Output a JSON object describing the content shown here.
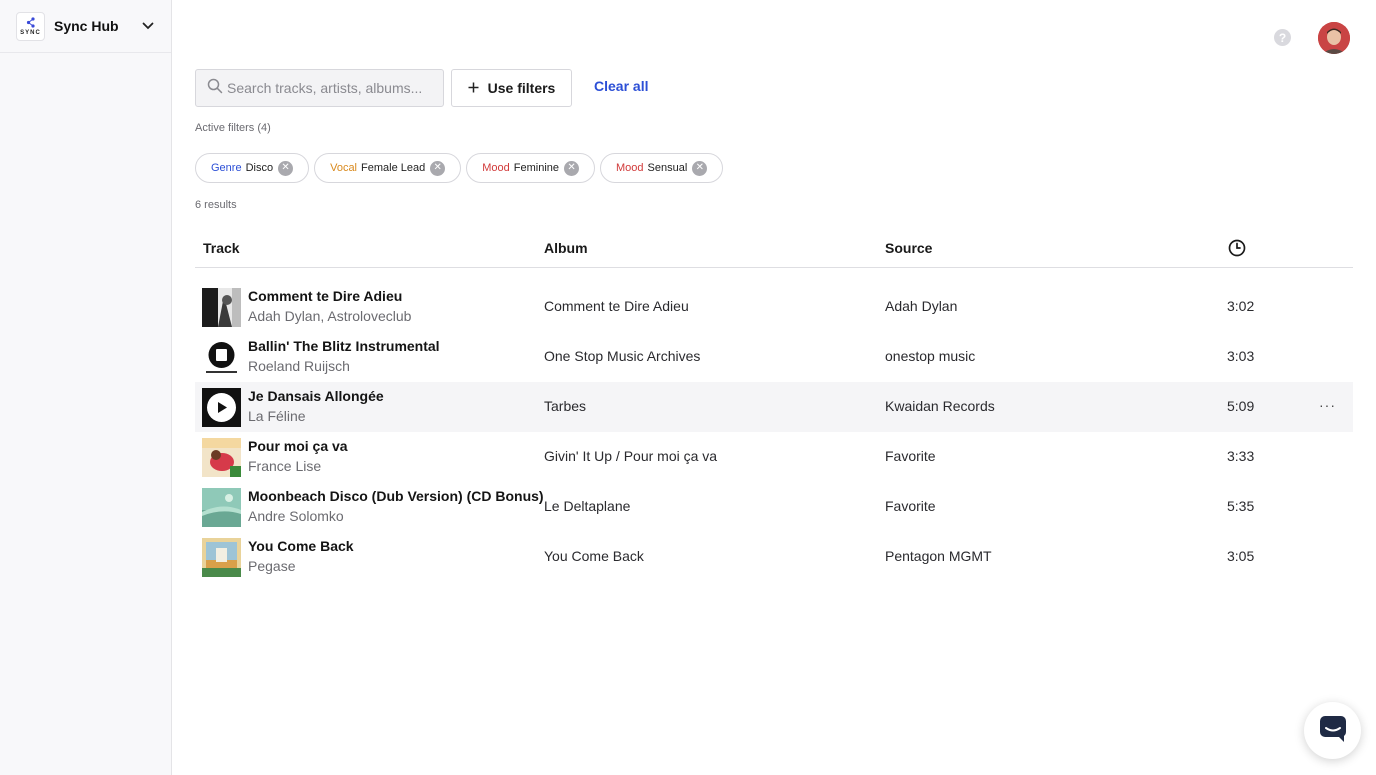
{
  "sidebar": {
    "workspace_name": "Sync Hub",
    "logo_text": "SYNC"
  },
  "header": {
    "help_symbol": "?"
  },
  "search": {
    "placeholder": "Search tracks, artists, albums..."
  },
  "toolbar": {
    "filters_label": "Use filters",
    "clear_label": "Clear all"
  },
  "filters": {
    "active_label": "Active filters (4)",
    "chips": [
      {
        "key": "Genre",
        "value": "Disco",
        "key_color": "#2c4fd6"
      },
      {
        "key": "Vocal",
        "value": "Female Lead",
        "key_color": "#d98a1e"
      },
      {
        "key": "Mood",
        "value": "Feminine",
        "key_color": "#d13a3a"
      },
      {
        "key": "Mood",
        "value": "Sensual",
        "key_color": "#d13a3a"
      }
    ]
  },
  "results_label": "6 results",
  "table": {
    "headers": {
      "track": "Track",
      "album": "Album",
      "source": "Source"
    },
    "rows": [
      {
        "title": "Comment te Dire Adieu",
        "artist": "Adah Dylan, Astroloveclub",
        "album": "Comment te Dire Adieu",
        "source": "Adah Dylan",
        "duration": "3:02"
      },
      {
        "title": "Ballin' The Blitz Instrumental",
        "artist": "Roeland Ruijsch",
        "album": "One Stop Music Archives",
        "source": "onestop music",
        "duration": "3:03"
      },
      {
        "title": "Je Dansais Allongée",
        "artist": "La Féline",
        "album": "Tarbes",
        "source": "Kwaidan Records",
        "duration": "5:09"
      },
      {
        "title": "Pour moi ça va",
        "artist": "France Lise",
        "album": "Givin' It Up / Pour moi ça va",
        "source": "Favorite",
        "duration": "3:33"
      },
      {
        "title": "Moonbeach Disco (Dub Version) (CD Bonus)",
        "artist": "Andre Solomko",
        "album": "Le Deltaplane",
        "source": "Favorite",
        "duration": "5:35"
      },
      {
        "title": "You Come Back",
        "artist": "Pegase",
        "album": "You Come Back",
        "source": "Pentagon MGMT",
        "duration": "3:05"
      }
    ]
  },
  "colors": {
    "accent": "#2c4fd6",
    "hover_row": "#f5f5f7"
  }
}
